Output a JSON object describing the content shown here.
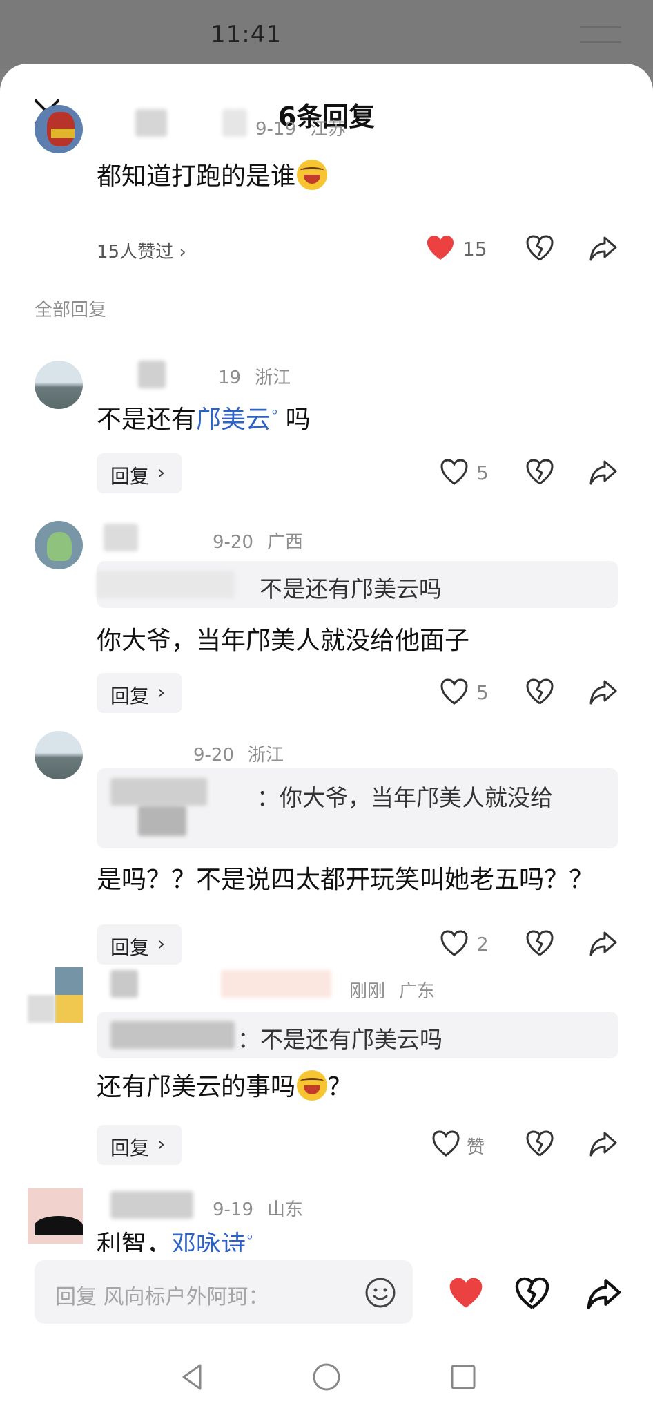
{
  "status": {
    "time": "11:41"
  },
  "header": {
    "title": "6条回复",
    "close_icon": "close-icon"
  },
  "top_comment": {
    "date": "9-19",
    "region": "江苏",
    "text": "都知道打跑的是谁",
    "likes_text": "15人赞过 ›",
    "like_count": "15"
  },
  "section_label": "全部回复",
  "replies": [
    {
      "date": "19",
      "region": "浙江",
      "text_before": "不是还有",
      "link": "邝美云",
      "text_after": " 吗",
      "reply_label": "回复",
      "like_count": "5"
    },
    {
      "date": "9-20",
      "region": "广西",
      "quote": "不是还有邝美云吗",
      "text": "你大爷，当年邝美人就没给他面子",
      "reply_label": "回复",
      "like_count": "5"
    },
    {
      "date": "9-20",
      "region": "浙江",
      "quote": "：你大爷，当年邝美人就没给",
      "text": "是吗？？不是说四太都开玩笑叫她老五吗？？",
      "reply_label": "回复",
      "like_count": "2"
    },
    {
      "date": "刚刚",
      "region": "广东",
      "quote": "：不是还有邝美云吗",
      "text": "还有邝美云的事吗",
      "text_tail": "？",
      "reply_label": "回复",
      "like_count": "赞"
    },
    {
      "date": "9-19",
      "region": "山东",
      "text_before": "利智，",
      "link": "邓咏诗"
    }
  ],
  "input": {
    "placeholder": "回复 风向标户外阿珂："
  },
  "colors": {
    "like_red": "#ec4141",
    "link_blue": "#2f62c6",
    "meta_gray": "#8e8e8e"
  }
}
